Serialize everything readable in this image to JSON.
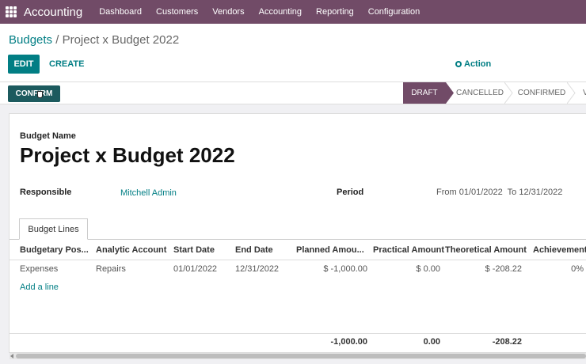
{
  "navbar": {
    "app_name": "Accounting",
    "menu": [
      "Dashboard",
      "Customers",
      "Vendors",
      "Accounting",
      "Reporting",
      "Configuration"
    ]
  },
  "control": {
    "breadcrumb_parent": "Budgets",
    "breadcrumb_sep": " / ",
    "breadcrumb_current": "Project x Budget 2022",
    "edit_label": "EDIT",
    "create_label": "CREATE",
    "action_label": "Action"
  },
  "statusbar": {
    "confirm_label": "CONFIRM",
    "stages": [
      "DRAFT",
      "CANCELLED",
      "CONFIRMED",
      "V"
    ],
    "active_stage": "DRAFT"
  },
  "form": {
    "budget_name_label": "Budget Name",
    "budget_name": "Project x Budget 2022",
    "responsible_label": "Responsible",
    "responsible_value": "Mitchell Admin",
    "period_label": "Period",
    "period_value": "From 01/01/2022  To 12/31/2022"
  },
  "tabs": {
    "budget_lines": "Budget Lines"
  },
  "table": {
    "headers": [
      "Budgetary Pos...",
      "Analytic Account",
      "Start Date",
      "End Date",
      "Planned Amou...",
      "Practical Amount",
      "Theoretical Amount",
      "Achievement"
    ],
    "rows": [
      [
        "Expenses",
        "Repairs",
        "01/01/2022",
        "12/31/2022",
        "$ -1,000.00",
        "$ 0.00",
        "$ -208.22",
        "0%"
      ]
    ],
    "add_line": "Add a line",
    "totals": {
      "planned": "-1,000.00",
      "practical": "0.00",
      "theoretical": "-208.22"
    }
  },
  "colors": {
    "primary": "#714B67",
    "accent": "#017e84"
  }
}
